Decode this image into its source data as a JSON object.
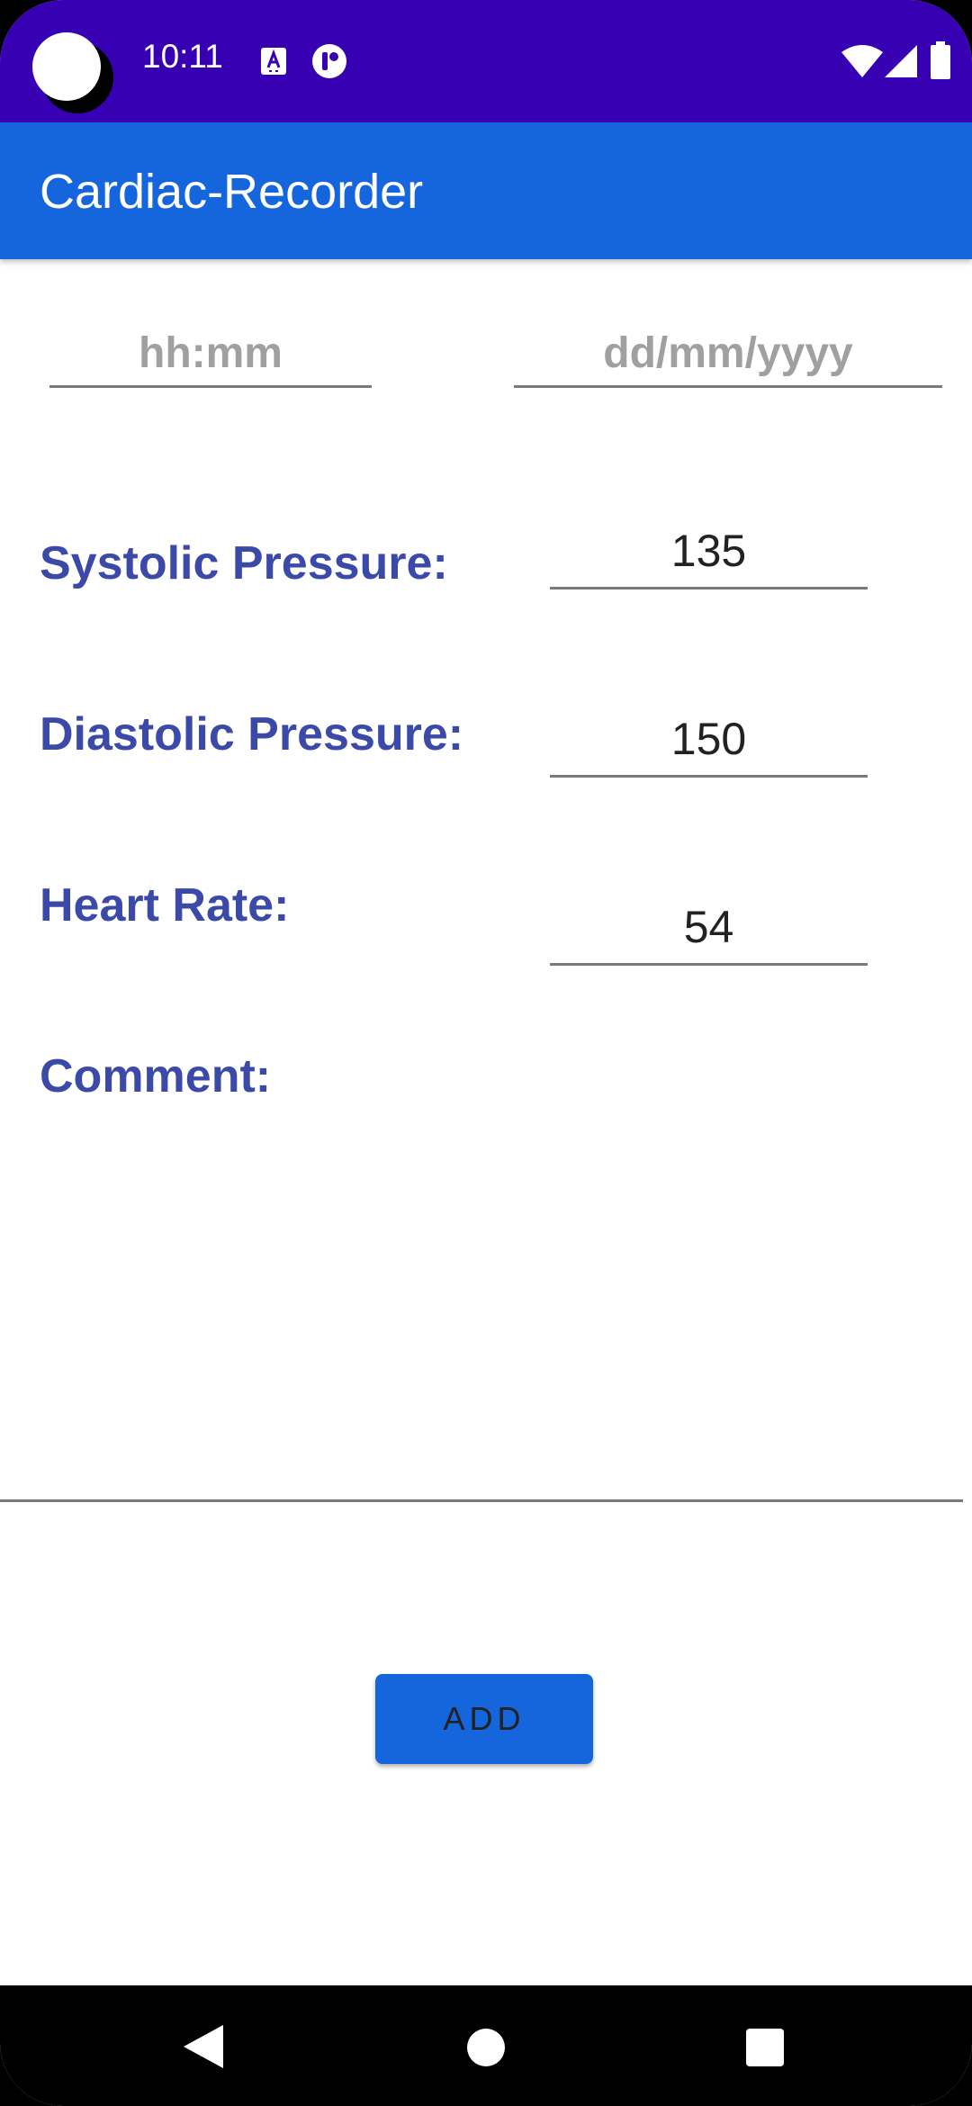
{
  "status_bar": {
    "time": "10:11",
    "background": "#3700b3"
  },
  "app_bar": {
    "title": "Cardiac-Recorder",
    "background": "#1565dd"
  },
  "form": {
    "time_placeholder": "hh:mm",
    "date_placeholder": "dd/mm/yyyy",
    "systolic_label": "Systolic Pressure:",
    "systolic_value": "135",
    "diastolic_label": "Diastolic Pressure:",
    "diastolic_value": "150",
    "heart_rate_label": "Heart Rate:",
    "heart_rate_value": "54",
    "comment_label": "Comment:",
    "comment_value": "",
    "label_color": "#3b4aa8"
  },
  "actions": {
    "add_label": "ADD"
  },
  "icons": {
    "status": [
      "camera-cutout-icon",
      "text-notification-icon",
      "app-notification-icon",
      "wifi-icon",
      "signal-icon",
      "battery-icon"
    ],
    "navigation": [
      "back-icon",
      "home-icon",
      "recents-icon"
    ]
  }
}
